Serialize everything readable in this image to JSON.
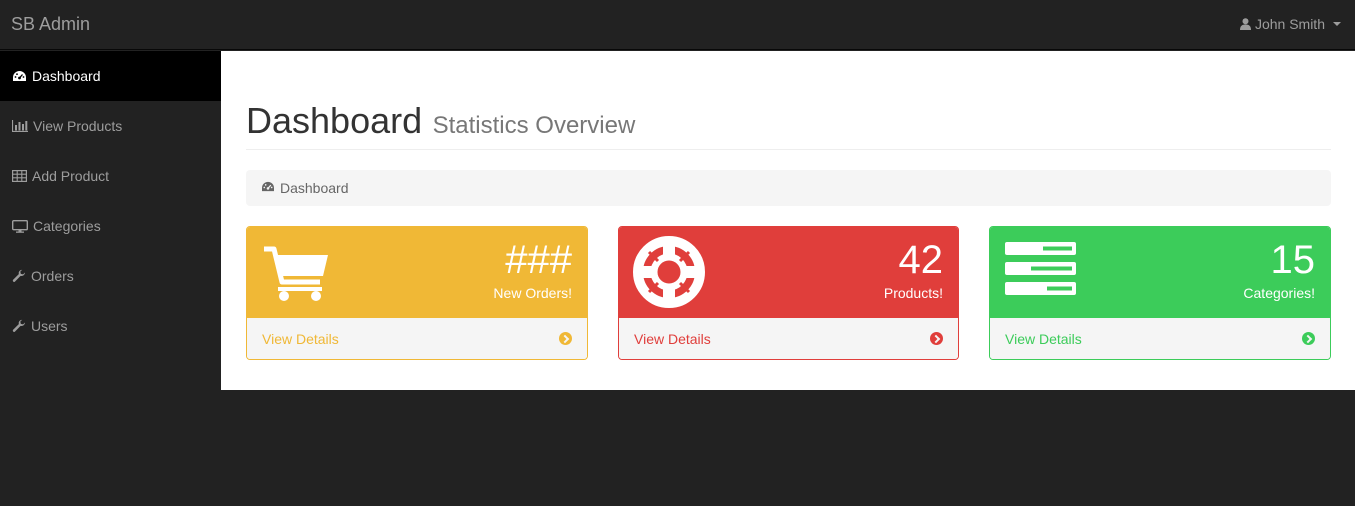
{
  "brand": "SB Admin",
  "user": {
    "name": "John Smith"
  },
  "sidebar": {
    "items": [
      {
        "label": "Dashboard",
        "icon": "dashboard-icon",
        "active": true
      },
      {
        "label": "View Products",
        "icon": "bar-chart-icon"
      },
      {
        "label": "Add Product",
        "icon": "table-icon"
      },
      {
        "label": "Categories",
        "icon": "desktop-icon"
      },
      {
        "label": "Orders",
        "icon": "wrench-icon"
      },
      {
        "label": "Users",
        "icon": "wrench-icon"
      }
    ]
  },
  "page": {
    "title": "Dashboard",
    "subtitle": "Statistics Overview"
  },
  "breadcrumb": {
    "label": "Dashboard",
    "icon": "dashboard-icon"
  },
  "panels": [
    {
      "count": "###",
      "label": "New Orders!",
      "link": "View Details",
      "icon": "shopping-cart-icon",
      "color": "#f0b836"
    },
    {
      "count": "42",
      "label": "Products!",
      "link": "View Details",
      "icon": "life-ring-icon",
      "color": "#e03e3b"
    },
    {
      "count": "15",
      "label": "Categories!",
      "link": "View Details",
      "icon": "tasks-icon",
      "color": "#3ccc5a"
    }
  ]
}
